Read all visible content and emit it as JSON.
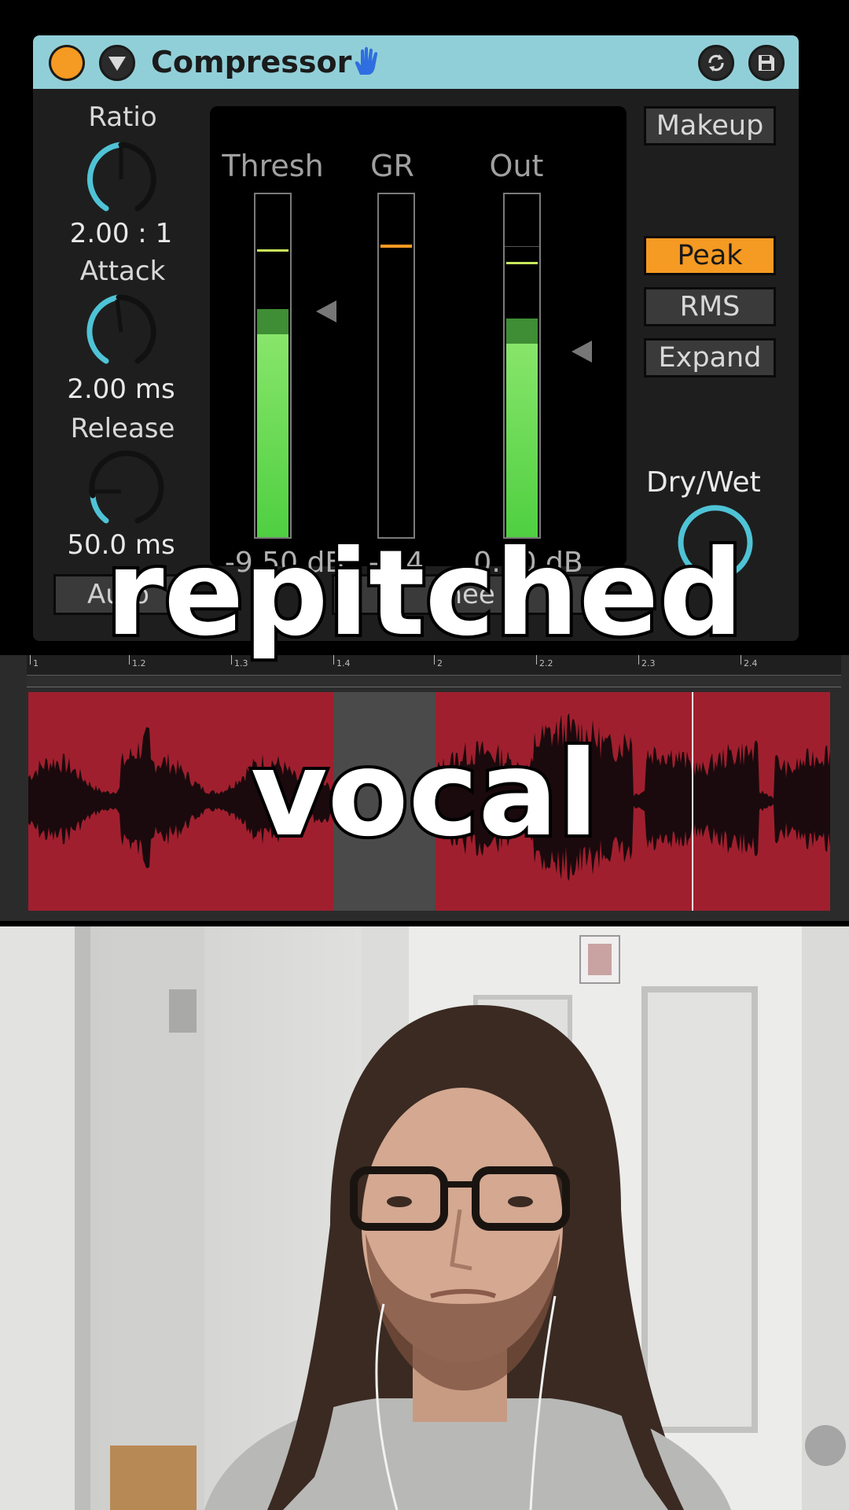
{
  "device": {
    "title": "Compressor",
    "knobs": {
      "ratio": {
        "label": "Ratio",
        "value": "2.00 : 1"
      },
      "attack": {
        "label": "Attack",
        "value": "2.00 ms"
      },
      "release": {
        "label": "Release",
        "value": "50.0 ms"
      }
    },
    "meters": {
      "thresh": {
        "label": "Thresh",
        "value": "-9.50 dB"
      },
      "gr": {
        "label": "GR",
        "value": "-2.4"
      },
      "out": {
        "label": "Out",
        "value": "0.00 dB"
      }
    },
    "buttons": {
      "makeup": "Makeup",
      "peak": "Peak",
      "rms": "RMS",
      "expand": "Expand"
    },
    "drywet_label": "Dry/Wet",
    "bottom_row": {
      "auto": "Auto",
      "knee": "Knee"
    },
    "colors": {
      "titlebar": "#91cfd8",
      "accent": "#f59a22",
      "knob_arc": "#4fc3d6",
      "meter": "#6ed854"
    }
  },
  "timeline": {
    "ruler_labels": [
      "1",
      "1.2",
      "1.3",
      "1.4",
      "2",
      "2.2",
      "2.3",
      "2.4"
    ],
    "clip_color": "#a01f2e"
  },
  "caption": {
    "line1": "repitched",
    "line2": "vocal"
  }
}
